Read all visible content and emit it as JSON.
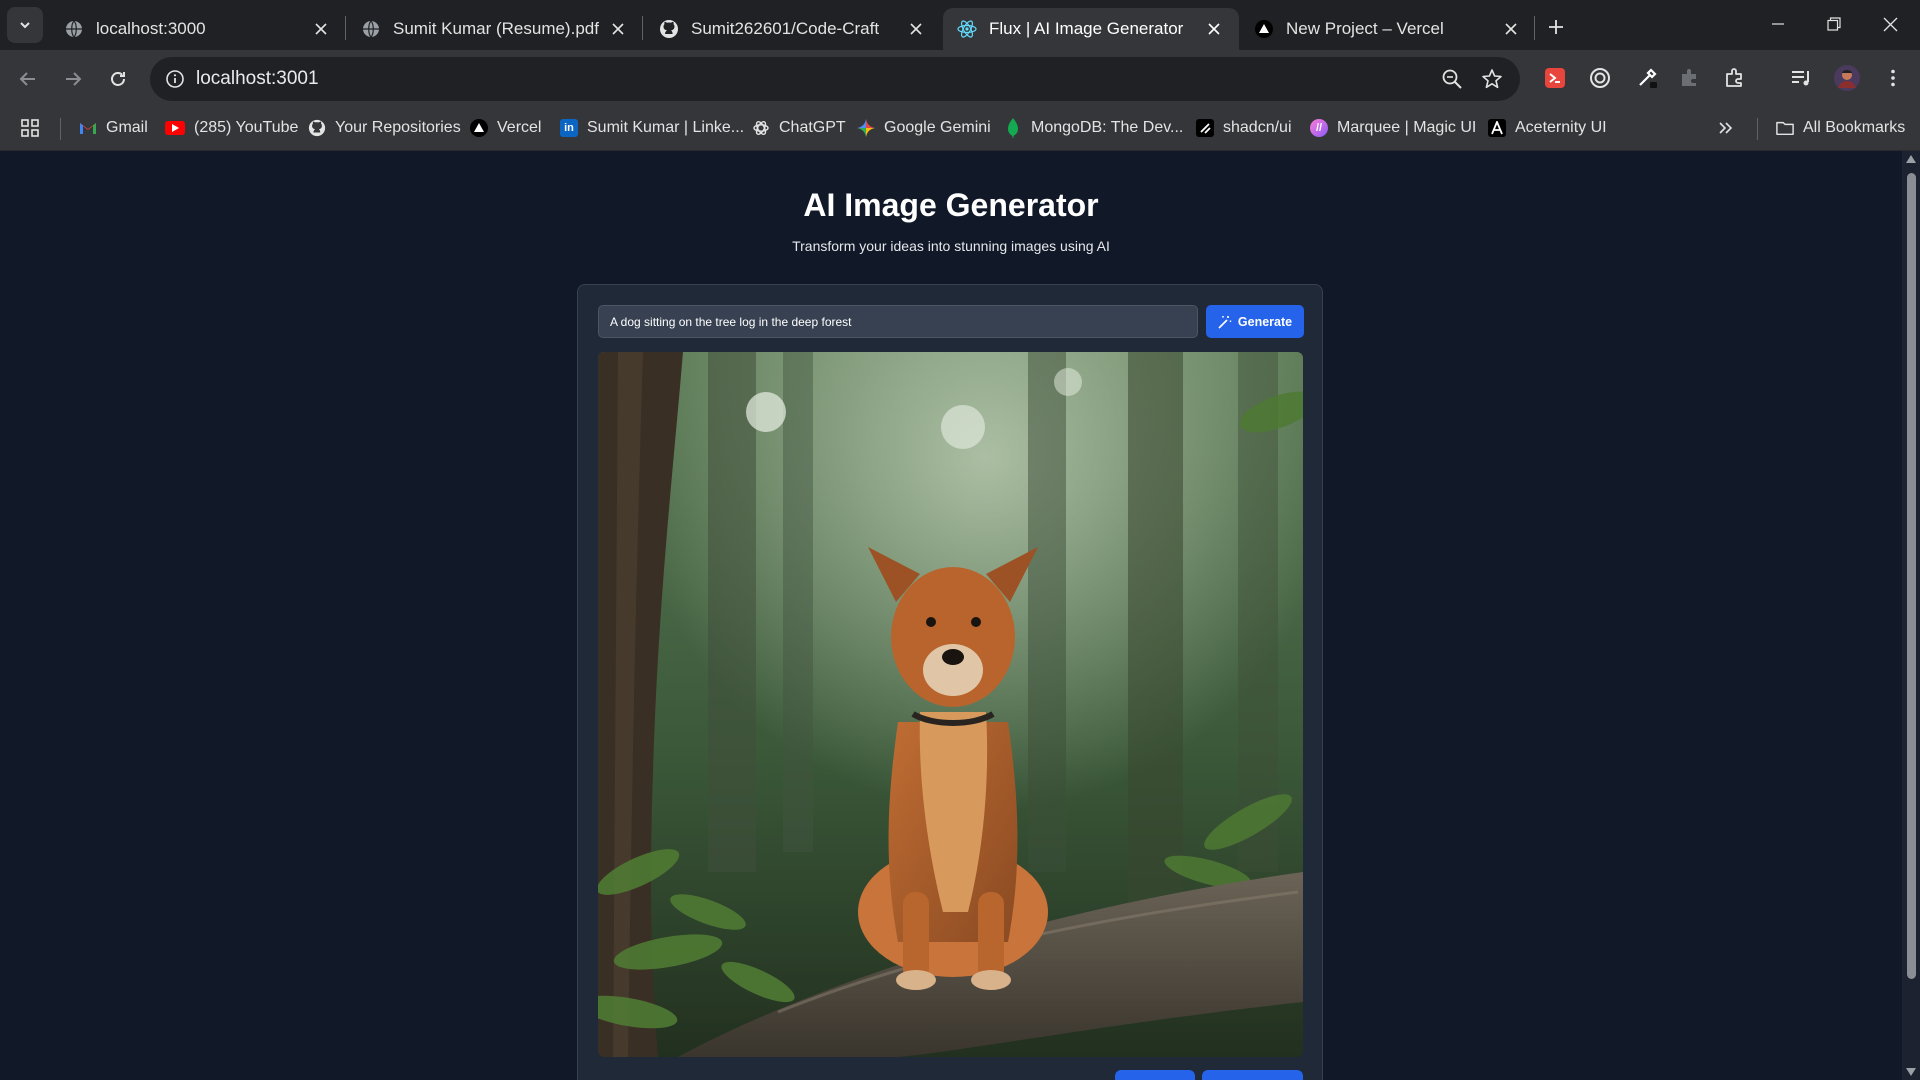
{
  "tabs": [
    {
      "title": "localhost:3000",
      "icon": "globe-icon"
    },
    {
      "title": "Sumit Kumar (Resume).pdf",
      "icon": "globe-icon"
    },
    {
      "title": "Sumit262601/Code-Craft",
      "icon": "github-icon"
    },
    {
      "title": "Flux | AI Image Generator",
      "icon": "react-icon",
      "active": true
    },
    {
      "title": "New Project – Vercel",
      "icon": "vercel-icon"
    }
  ],
  "toolbar": {
    "url": "localhost:3001"
  },
  "bookmarks": {
    "items": [
      {
        "label": "Gmail",
        "icon": "gmail-icon"
      },
      {
        "label": "(285) YouTube",
        "icon": "youtube-icon"
      },
      {
        "label": "Your Repositories",
        "icon": "github-icon"
      },
      {
        "label": "Vercel",
        "icon": "vercel-icon"
      },
      {
        "label": "Sumit Kumar | Linke...",
        "icon": "linkedin-icon"
      },
      {
        "label": "ChatGPT",
        "icon": "chatgpt-icon"
      },
      {
        "label": "Google Gemini",
        "icon": "gemini-icon"
      },
      {
        "label": "MongoDB: The Dev...",
        "icon": "mongodb-icon"
      },
      {
        "label": "shadcn/ui",
        "icon": "shadcn-icon"
      },
      {
        "label": "Marquee | Magic UI",
        "icon": "magicui-icon"
      },
      {
        "label": "Aceternity UI",
        "icon": "aceternity-icon"
      }
    ],
    "all_bookmarks": "All Bookmarks"
  },
  "page": {
    "title": "AI Image Generator",
    "subtitle": "Transform your ideas into stunning images using AI",
    "prompt_value": "A dog sitting on the tree log in the deep forest",
    "generate_label": "Generate"
  },
  "colors": {
    "page_bg": "#111827",
    "card_bg": "#1f2937",
    "accent": "#2563eb"
  }
}
